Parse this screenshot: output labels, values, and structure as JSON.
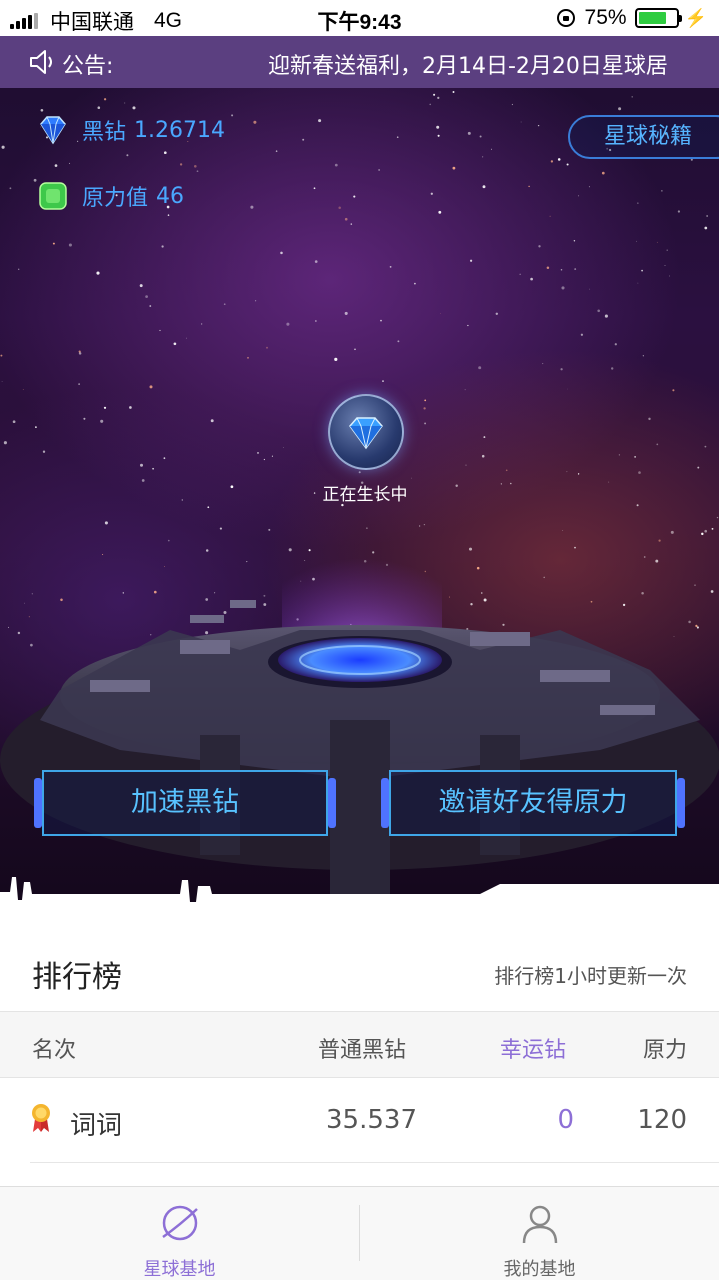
{
  "status_bar": {
    "carrier": "中国联通",
    "network": "4G",
    "time": "下午9:43",
    "battery": "75%",
    "battery_level": 0.75
  },
  "notice": {
    "label": "公告:",
    "text": "迎新春送福利，2月14日-2月20日星球居"
  },
  "balances": {
    "black_diamond": {
      "label": "黑钻",
      "value": "1.26714",
      "icon": "blue-diamond-icon"
    },
    "force": {
      "label": "原力值",
      "value": "46",
      "icon": "green-gem-icon"
    }
  },
  "secret_button": "星球秘籍",
  "growing": {
    "label": "正在生长中",
    "icon": "diamond-orb-icon"
  },
  "actions": {
    "speed_up": "加速黑钻",
    "invite": "邀请好友得原力"
  },
  "ranking": {
    "title": "排行榜",
    "note": "排行榜1小时更新一次",
    "columns": {
      "name": "名次",
      "normal": "普通黑钻",
      "lucky": "幸运钻",
      "force": "原力"
    },
    "rows": [
      {
        "name": "词词",
        "normal": "35.537",
        "lucky": "0",
        "force": "120",
        "icon": "gold-medal-icon"
      }
    ]
  },
  "tabs": [
    {
      "label": "星球基地",
      "icon": "planet-icon",
      "active": true
    },
    {
      "label": "我的基地",
      "icon": "user-icon",
      "active": false
    }
  ],
  "colors": {
    "accent_purple": "#8d6fd6",
    "notice_bar": "#5b3f80",
    "balance_blue": "#4aa8ff",
    "button_cyan": "#58c2ff"
  }
}
